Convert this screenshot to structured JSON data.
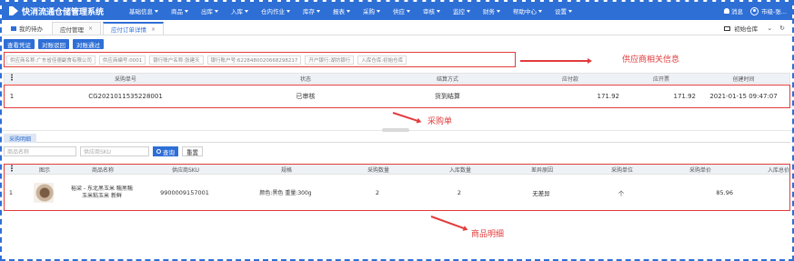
{
  "app": {
    "title": "快消流通仓储管理系统",
    "menu": [
      "基础信息",
      "商品",
      "出库",
      "入库",
      "仓内作业",
      "库存",
      "报表",
      "采购",
      "供应",
      "审核",
      "监控",
      "财务",
      "帮助中心",
      "设置"
    ],
    "notifications_label": "消息",
    "user_label": "市级-张..."
  },
  "tabs": {
    "home": "我的待办",
    "items": [
      "应付管理",
      "应付订单详情"
    ],
    "warehouse": "初始仓库"
  },
  "actions": {
    "view_voucher": "查看凭证",
    "reject_account": "对账驳回",
    "approve_account": "对账通过"
  },
  "supplier": {
    "name": "供应商名称:广东省佳德副食有限公司",
    "code": "供应商编号:0001",
    "bank_account_name": "银行账户名称:张建天",
    "bank_account_no": "银行账户号:6228480020668298217",
    "bank": "开户银行:湖坊银行",
    "warehouse": "入库仓库:初始仓库"
  },
  "annotations": {
    "supplier_info": "供应商相关信息",
    "purchase_order": "采购单",
    "product_detail": "商品明细"
  },
  "po_table": {
    "headers": [
      "采购单号",
      "状态",
      "结算方式",
      "应付款",
      "应开票",
      "创建时间"
    ],
    "row": {
      "index": "1",
      "order_no": "CG2021011535228001",
      "status": "已审核",
      "settlement": "货到结算",
      "payable": "171.92",
      "invoice": "171.92",
      "created_at": "2021-01-15 09:47:07"
    }
  },
  "detail": {
    "section_label": "采购明细",
    "search": {
      "name_placeholder": "商品名称",
      "sku_placeholder": "供应商SKU",
      "query_label": "查询",
      "reset_label": "重置"
    },
    "headers": [
      "图示",
      "商品名称",
      "供应商SKU",
      "规格",
      "采购数量",
      "入库数量",
      "差异原因",
      "采购单位",
      "采购单价",
      "入库总价"
    ],
    "row": {
      "index": "1",
      "name": "裕梁 - 东北黑玉米 糯黑糯玉米粘玉米 新鲜",
      "sku": "9900009157001",
      "spec": "颜色:黑色 重量:300g",
      "purchase_qty": "2",
      "inbound_qty": "2",
      "diff_reason": "无差异",
      "unit": "个",
      "unit_price": "85.96",
      "total": ""
    }
  },
  "colors": {
    "primary": "#2e6fd6",
    "annotation": "#e23c3c"
  }
}
